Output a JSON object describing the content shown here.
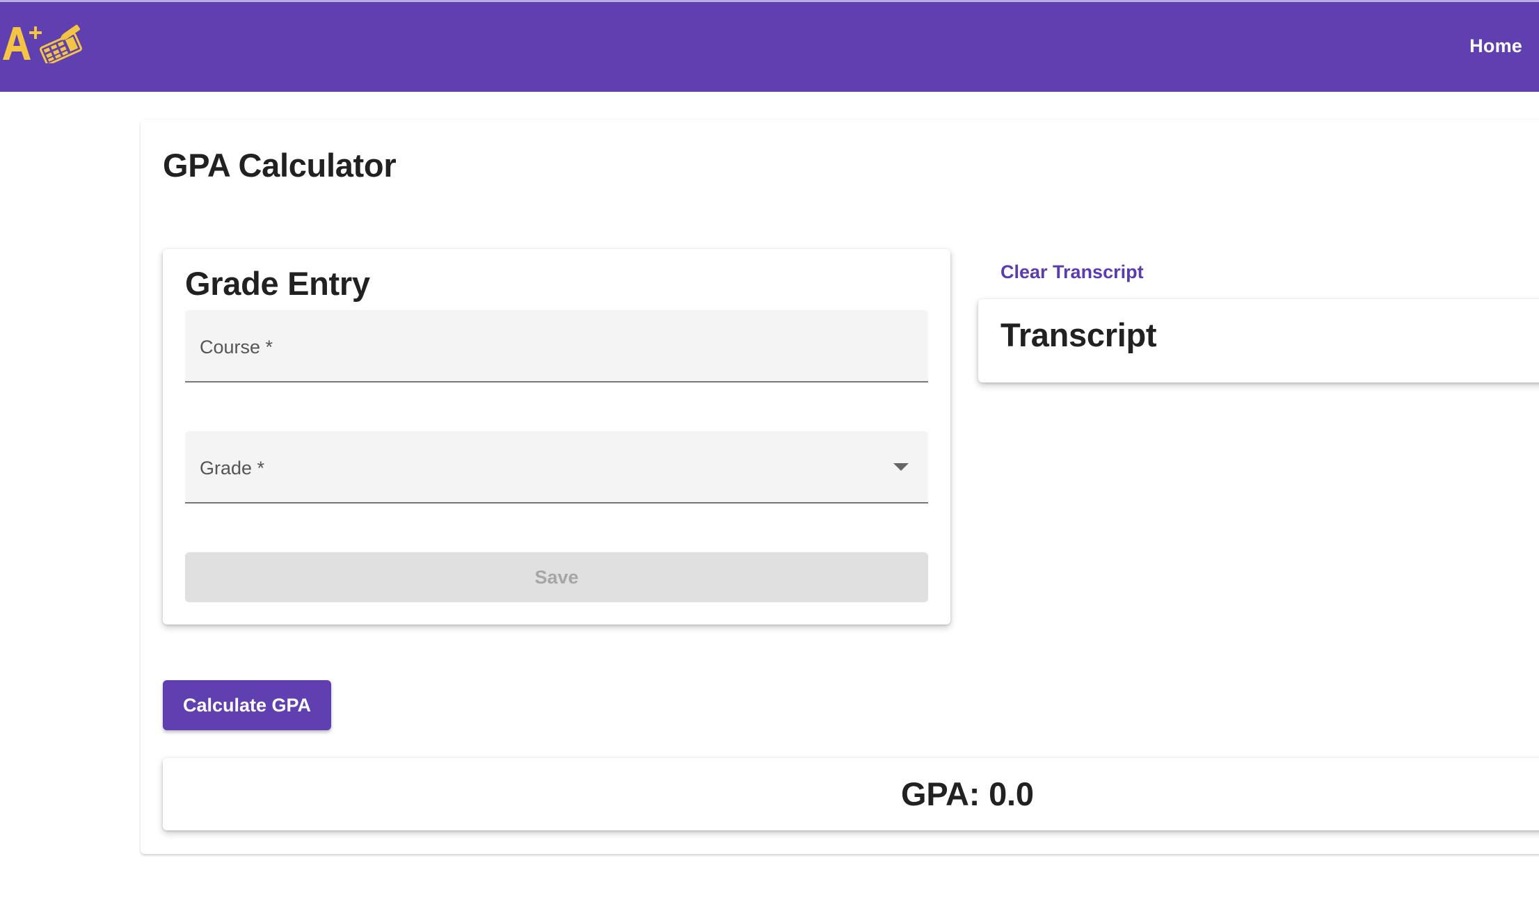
{
  "header": {
    "logo_icon": "a-plus-calculator-logo",
    "nav_home": "Home",
    "brand_color": "#6040b0",
    "logo_color": "#f4c542"
  },
  "main": {
    "title": "GPA Calculator"
  },
  "grade_entry": {
    "title": "Grade Entry",
    "course_label": "Course *",
    "course_value": "",
    "grade_label": "Grade *",
    "grade_value": "",
    "grade_icon": "dropdown-arrow-icon",
    "save_label": "Save",
    "save_enabled": false
  },
  "transcript": {
    "clear_label": "Clear Transcript",
    "title": "Transcript"
  },
  "calculate": {
    "label": "Calculate GPA"
  },
  "result": {
    "gpa_text": "GPA: 0.0"
  }
}
